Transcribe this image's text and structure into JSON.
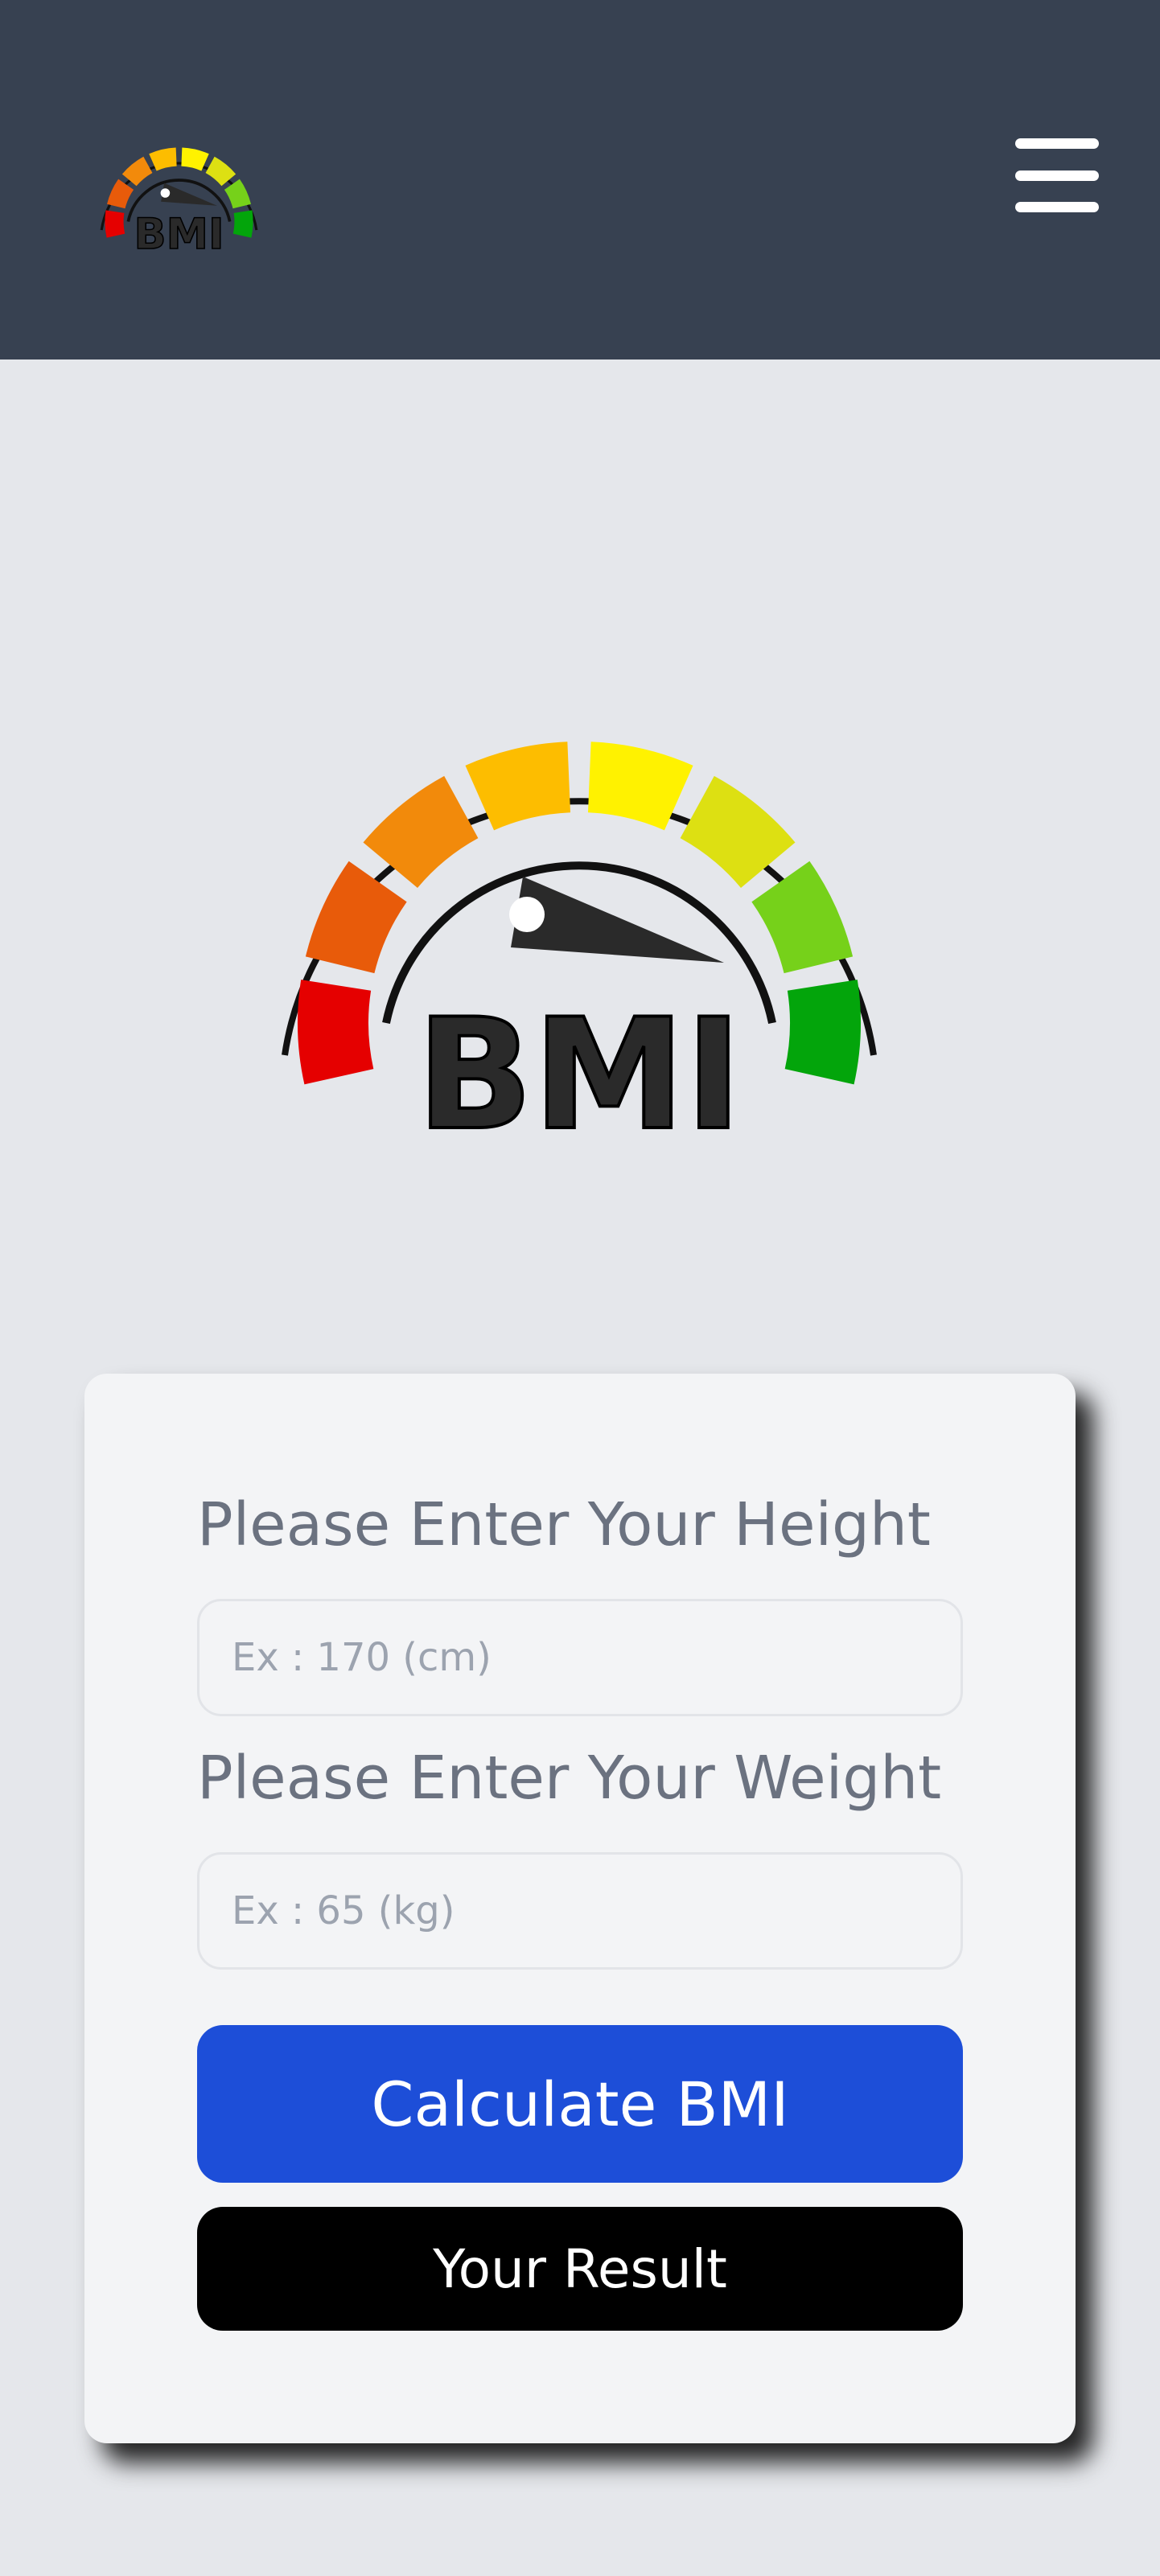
{
  "header": {
    "logo_text": "BMI",
    "logo_icon": "bmi-gauge-logo",
    "menu_icon": "hamburger-menu-icon",
    "background": "#374151"
  },
  "hero": {
    "gauge_text": "BMI",
    "gauge_icon": "bmi-gauge-icon",
    "segment_colors": [
      "#e50000",
      "#e85b0a",
      "#f28a0b",
      "#fdbd00",
      "#fff200",
      "#dde012",
      "#76d11a",
      "#03a50b"
    ]
  },
  "form": {
    "height_label": "Please Enter Your Height",
    "height_placeholder": "Ex : 170 (cm)",
    "weight_label": "Please Enter Your Weight",
    "weight_placeholder": "Ex : 65 (kg)",
    "calculate_label": "Calculate BMI",
    "result_label": "Your Result"
  },
  "colors": {
    "primary_button": "#1d4ed8",
    "result_button": "#000000",
    "page_background": "#e5e7eb",
    "card_background": "#f3f4f6"
  }
}
